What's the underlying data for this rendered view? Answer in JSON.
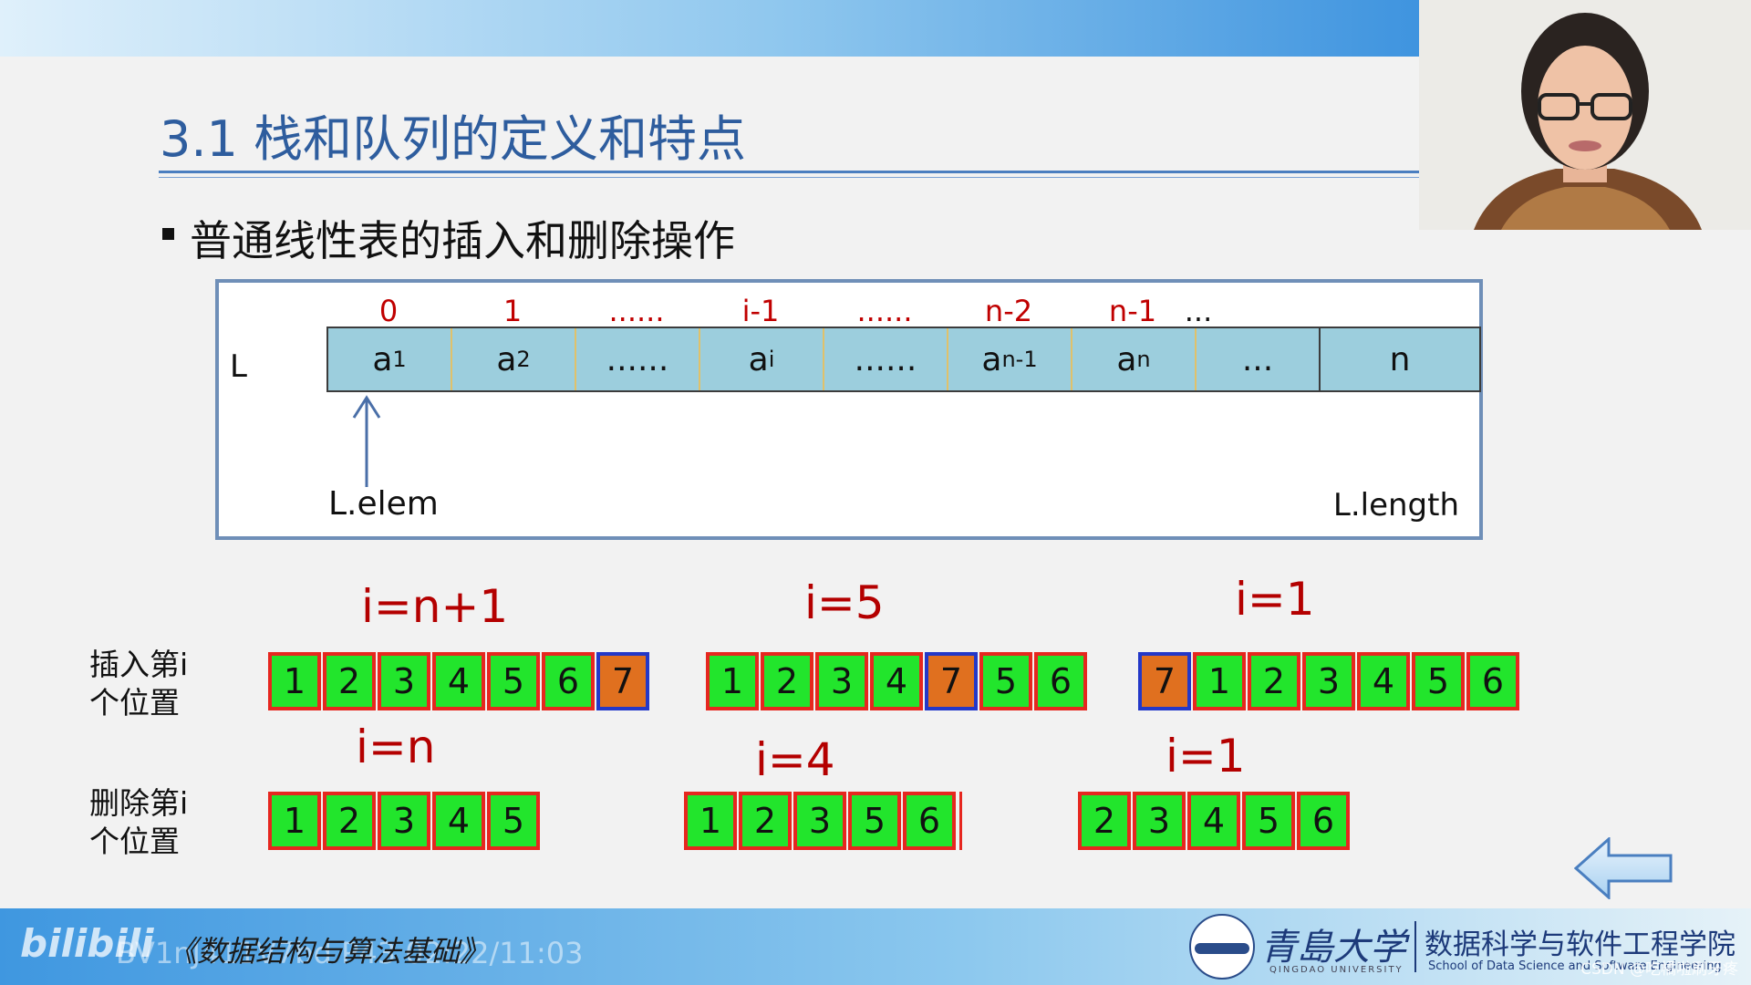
{
  "slide": {
    "title": "3.1 栈和队列的定义和特点",
    "bullet": "普通线性表的插入和删除操作"
  },
  "structure": {
    "row_label": "L",
    "indices": [
      "0",
      "1",
      "......",
      "i-1",
      "......",
      "n-2",
      "n-1",
      "..."
    ],
    "cells": [
      {
        "base": "a",
        "sub": "1"
      },
      {
        "base": "a",
        "sub": "2"
      },
      {
        "base": "......",
        "sub": ""
      },
      {
        "base": "a",
        "sub": "i"
      },
      {
        "base": "......",
        "sub": ""
      },
      {
        "base": "a",
        "sub": "n-1"
      },
      {
        "base": "a",
        "sub": "n"
      },
      {
        "base": "...",
        "sub": ""
      },
      {
        "base": "n",
        "sub": ""
      }
    ],
    "elem_label": "L.elem",
    "length_label": "L.length"
  },
  "insert": {
    "row_title_line1": "插入第i",
    "row_title_line2": "个位置",
    "groups": [
      {
        "label": "i=n+1",
        "boxes": [
          "1",
          "2",
          "3",
          "4",
          "5",
          "6",
          "7"
        ],
        "inserted_index": 6
      },
      {
        "label": "i=5",
        "boxes": [
          "1",
          "2",
          "3",
          "4",
          "7",
          "5",
          "6"
        ],
        "inserted_index": 4
      },
      {
        "label": "i=1",
        "boxes": [
          "7",
          "1",
          "2",
          "3",
          "4",
          "5",
          "6"
        ],
        "inserted_index": 0
      }
    ]
  },
  "delete": {
    "row_title_line1": "删除第i",
    "row_title_line2": "个位置",
    "groups": [
      {
        "label": "i=n",
        "boxes": [
          "1",
          "2",
          "3",
          "4",
          "5"
        ]
      },
      {
        "label": "i=4",
        "boxes": [
          "1",
          "2",
          "3",
          "5",
          "6"
        ]
      },
      {
        "label": "i=1",
        "boxes": [
          "2",
          "3",
          "4",
          "5",
          "6"
        ]
      }
    ]
  },
  "footer": {
    "bili_logo": "bilibili",
    "video_id": "BV1nJ411V7bd P43 02:22/11:03",
    "book_title": "《数据结构与算法基础》",
    "university": "青島大学",
    "university_en": "QINGDAO UNIVERSITY",
    "school_cn": "数据科学与软件工程学院",
    "school_en": "School of Data Science and Software Engineering",
    "csdn": "CSDN @吃橘啦刷牙疼"
  },
  "colors": {
    "title": "#2e5d9e",
    "index_red": "#c00000",
    "cell_fill": "#9ccedd",
    "box_green": "#22e52c",
    "box_border_red": "#e6271f",
    "inserted_orange": "#e0701f",
    "inserted_border_blue": "#2338c8"
  },
  "icons": {
    "nav_back": "left-arrow-icon",
    "pointer": "up-arrow-icon"
  }
}
